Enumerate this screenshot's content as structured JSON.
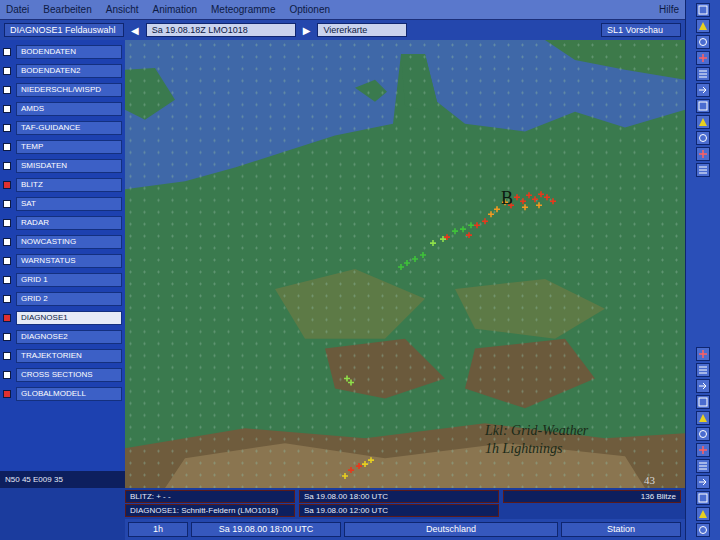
{
  "window": {
    "title": "DIAGNOSE1"
  },
  "menu": [
    {
      "label": "Datei"
    },
    {
      "label": "Bearbeiten"
    },
    {
      "label": "Ansicht"
    },
    {
      "label": "Animation"
    },
    {
      "label": "Meteogramme"
    },
    {
      "label": "Optionen"
    }
  ],
  "help": "Hilfe",
  "toolbar": {
    "field_button": "DIAGNOSE1 Feldauswahl",
    "prev": "◀",
    "time": "Sa 19.08.18Z LMO1018",
    "next": "▶",
    "view": "Viererkarte",
    "preview": "SL1 Vorschau"
  },
  "layers": [
    {
      "label": "BODENDATEN",
      "checked": false,
      "selected": false
    },
    {
      "label": "BODENDATEN2",
      "checked": false,
      "selected": false
    },
    {
      "label": "NIEDERSCHL/WISPD",
      "checked": false,
      "selected": false
    },
    {
      "label": "AMDS",
      "checked": false,
      "selected": false
    },
    {
      "label": "TAF-GUIDANCE",
      "checked": false,
      "selected": false
    },
    {
      "label": "TEMP",
      "checked": false,
      "selected": false
    },
    {
      "label": "SMISDATEN",
      "checked": false,
      "selected": false
    },
    {
      "label": "BLITZ",
      "checked": true,
      "selected": false
    },
    {
      "label": "SAT",
      "checked": false,
      "selected": false
    },
    {
      "label": "RADAR",
      "checked": false,
      "selected": false
    },
    {
      "label": "NOWCASTING",
      "checked": false,
      "selected": false
    },
    {
      "label": "WARNSTATUS",
      "checked": false,
      "selected": false
    },
    {
      "label": "GRID 1",
      "checked": false,
      "selected": false
    },
    {
      "label": "GRID 2",
      "checked": false,
      "selected": false
    },
    {
      "label": "DIAGNOSE1",
      "checked": true,
      "selected": true
    },
    {
      "label": "DIAGNOSE2",
      "checked": false,
      "selected": false
    },
    {
      "label": "TRAJEKTORIEN",
      "checked": false,
      "selected": false
    },
    {
      "label": "CROSS SECTIONS",
      "checked": false,
      "selected": false
    },
    {
      "label": "GLOBALMODELL",
      "checked": true,
      "selected": false
    }
  ],
  "coordinates": "N50 45 E009 35",
  "map": {
    "marker": "B",
    "annotation": [
      "Lkl: Grid-Weather",
      "1h Lightnings"
    ],
    "page_number": "43",
    "lightning_clusters": [
      {
        "color": "#e8381c"
      },
      {
        "color": "#f39a22"
      },
      {
        "color": "#3fc23a"
      },
      {
        "color": "#e8381c"
      },
      {
        "color": "#8fe04a"
      },
      {
        "color": "#e8d020"
      }
    ]
  },
  "status_rows": [
    {
      "layer": "BLITZ: + - -",
      "time": "Sa 19.08.00 18:00 UTC",
      "count": "136 Blitze"
    },
    {
      "layer": "DIAGNOSE1: Schnitt-Feldern (LMO1018)",
      "time": "Sa 19.08.00 12:00 UTC"
    }
  ],
  "bottom_bar": {
    "interval": "1h",
    "time": "Sa 19.08.00 18:00 UTC",
    "region": "Deutschland",
    "mode": "Station"
  }
}
